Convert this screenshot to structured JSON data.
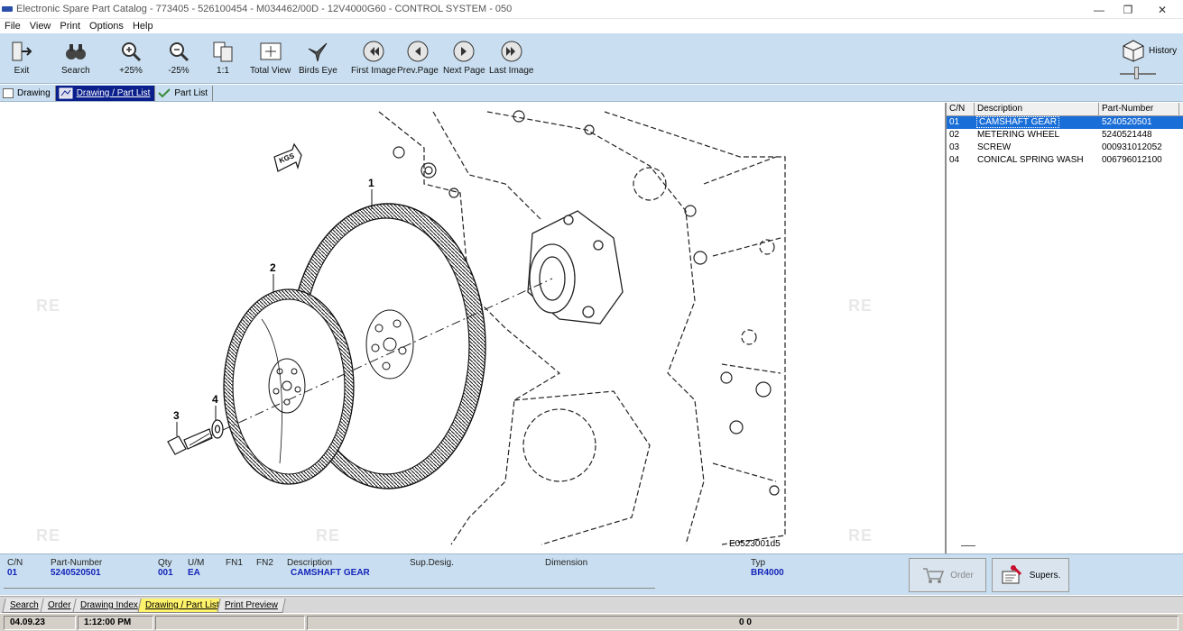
{
  "window": {
    "title": "Electronic Spare Part Catalog - 773405 - 526100454 - M034462/00D - 12V4000G60 - CONTROL SYSTEM - 050",
    "minimize_glyph": "—",
    "maximize_glyph": "❐",
    "close_glyph": "✕"
  },
  "menu": [
    "File",
    "View",
    "Print",
    "Options",
    "Help"
  ],
  "toolbar": {
    "exit": "Exit",
    "search": "Search",
    "zoom_in": "+25%",
    "zoom_out": "-25%",
    "actual_size": "1:1",
    "total_view": "Total View",
    "birds_eye": "Birds Eye",
    "first_image": "First Image",
    "prev_page": "Prev.Page",
    "next_page": "Next Page",
    "last_image": "Last Image",
    "history": "History",
    "zoom_slider_fraction": 0.45
  },
  "view_tabs": [
    "Drawing",
    "Drawing / Part List",
    "Part List"
  ],
  "active_view_tab": "Drawing / Part List",
  "drawing": {
    "code": "E0523001d5",
    "callouts": [
      "1",
      "2",
      "3",
      "4"
    ],
    "arrow_label": "KGS",
    "watermark": "RE"
  },
  "part_list": {
    "headers": [
      "C/N",
      "Description",
      "Part-Number"
    ],
    "rows": [
      {
        "cn": "01",
        "description": "CAMSHAFT GEAR",
        "part_number": "5240520501"
      },
      {
        "cn": "02",
        "description": "METERING WHEEL",
        "part_number": "5240521448"
      },
      {
        "cn": "03",
        "description": "SCREW",
        "part_number": "000931012052"
      },
      {
        "cn": "04",
        "description": "CONICAL SPRING WASH",
        "part_number": "006796012100"
      }
    ],
    "selected_index": 0
  },
  "detail": {
    "headers": {
      "cn": "C/N",
      "part_number": "Part-Number",
      "qty": "Qty",
      "um": "U/M",
      "fn1": "FN1",
      "fn2": "FN2",
      "description": "Description",
      "sup_desig": "Sup.Desig.",
      "dimension": "Dimension",
      "typ": "Typ"
    },
    "values": {
      "cn": "01",
      "part_number": "5240520501",
      "qty": "001",
      "um": "EA",
      "description": "CAMSHAFT GEAR",
      "typ": "BR4000"
    }
  },
  "actions": {
    "order": "Order",
    "supers": "Supers."
  },
  "bottom_tabs": [
    "Search",
    "Order",
    "Drawing Index",
    "Drawing / Part List",
    "Print Preview"
  ],
  "active_bottom_tab": "Drawing / Part List",
  "status": {
    "date": "04.09.23",
    "time": "1:12:00 PM",
    "counter": "0 0"
  },
  "colors": {
    "toolbar_bg": "#c9dff1",
    "selected_row": "#1a6ed8",
    "active_tab_bg": "#0a1f8c",
    "detail_value": "#1424b8",
    "active_bottom_tab": "#fff36b"
  }
}
